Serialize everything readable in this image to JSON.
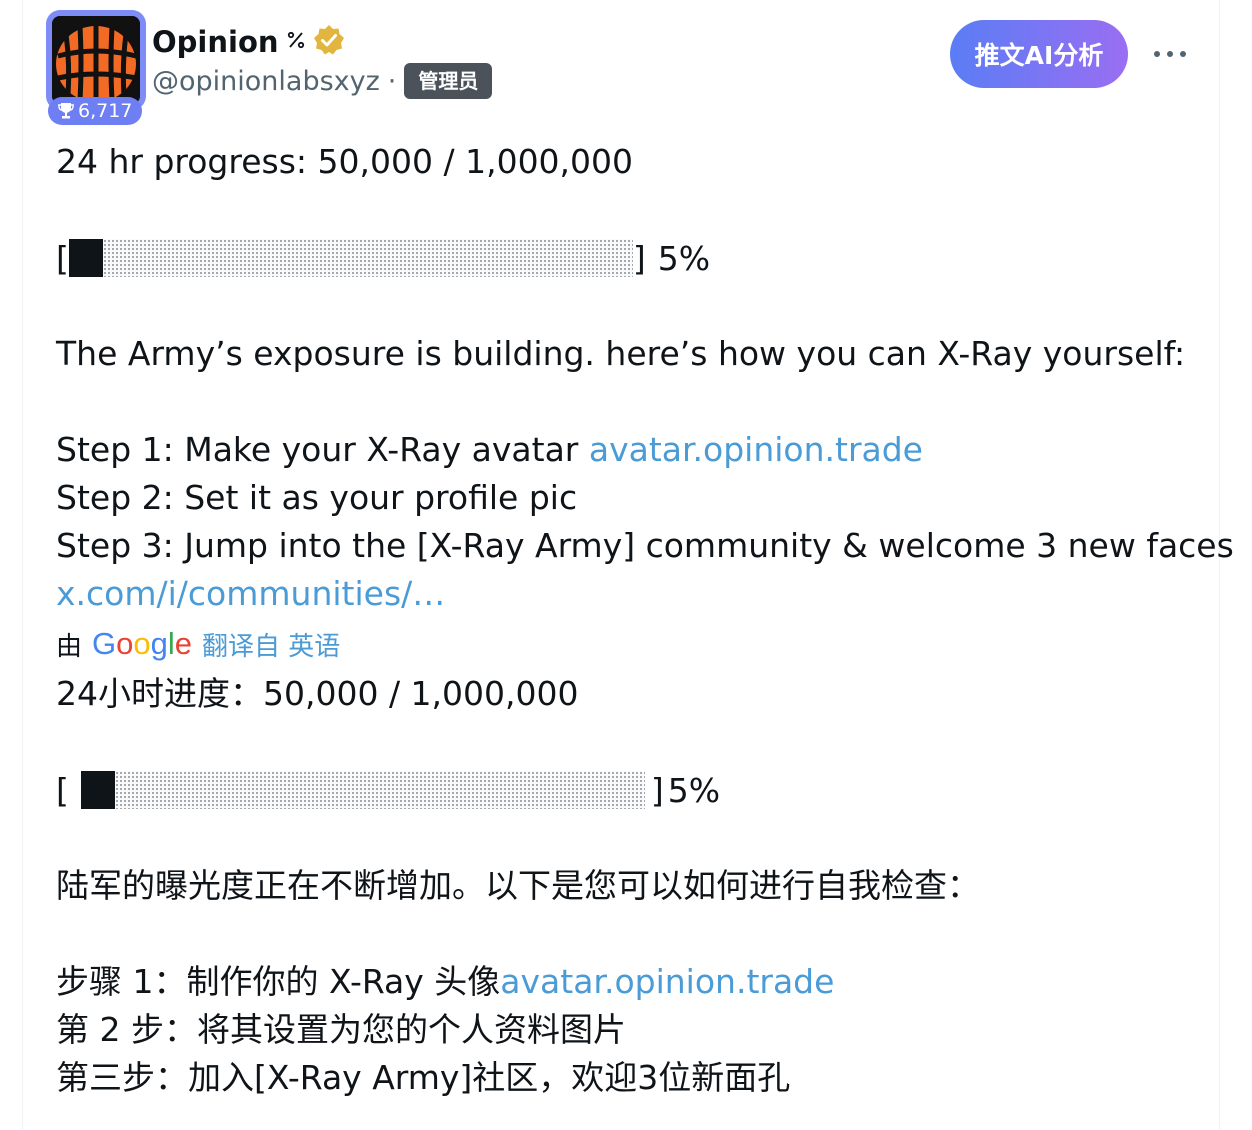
{
  "account": {
    "name": "Opinion",
    "name_glyph": "%",
    "handle": "@opinionlabsxyz",
    "separator": "·",
    "role_badge": "管理员",
    "score": "6,717",
    "verified_color": "#e2b53f",
    "avatar_colors": [
      "#f26a24",
      "#111111"
    ]
  },
  "actions": {
    "ai_button": "推文AI分析",
    "more": "•••"
  },
  "original": {
    "progress_line": "24 hr progress: 50,000 / 1,000,000",
    "bar_open": "[",
    "bar_close": "]",
    "bar_percent": "5%",
    "bar_fill_fraction": 0.05,
    "exposure_line": "The Army’s exposure is building. here’s how you can X-Ray yourself:",
    "step1_text": "Step 1: Make your X-Ray avatar ",
    "step1_link": "avatar.opinion.trade",
    "step2_text": "Step 2: Set it as your profile pic",
    "step3_text": "Step 3: Jump into the [X-Ray Army] community & welcome 3 new faces",
    "community_link": "x.com/i/communities/…"
  },
  "translation": {
    "by": "由",
    "google": "Google",
    "translated_from": "翻译自 英语",
    "progress_line": "24小时进度：50,000 / 1,000,000",
    "bar_open": "[",
    "bar_close": "]",
    "bar_percent": "5%",
    "exposure_line": "陆军的曝光度正在不断增加。以下是您可以如何进行自我检查：",
    "step1_text": "步骤 1：制作你的 X-Ray 头像",
    "step1_link": "avatar.opinion.trade",
    "step2_text": "第 2 步：将其设置为您的个人资料图片",
    "step3_text": "第三步：加入[X-Ray Army]社区，欢迎3位新面孔"
  }
}
